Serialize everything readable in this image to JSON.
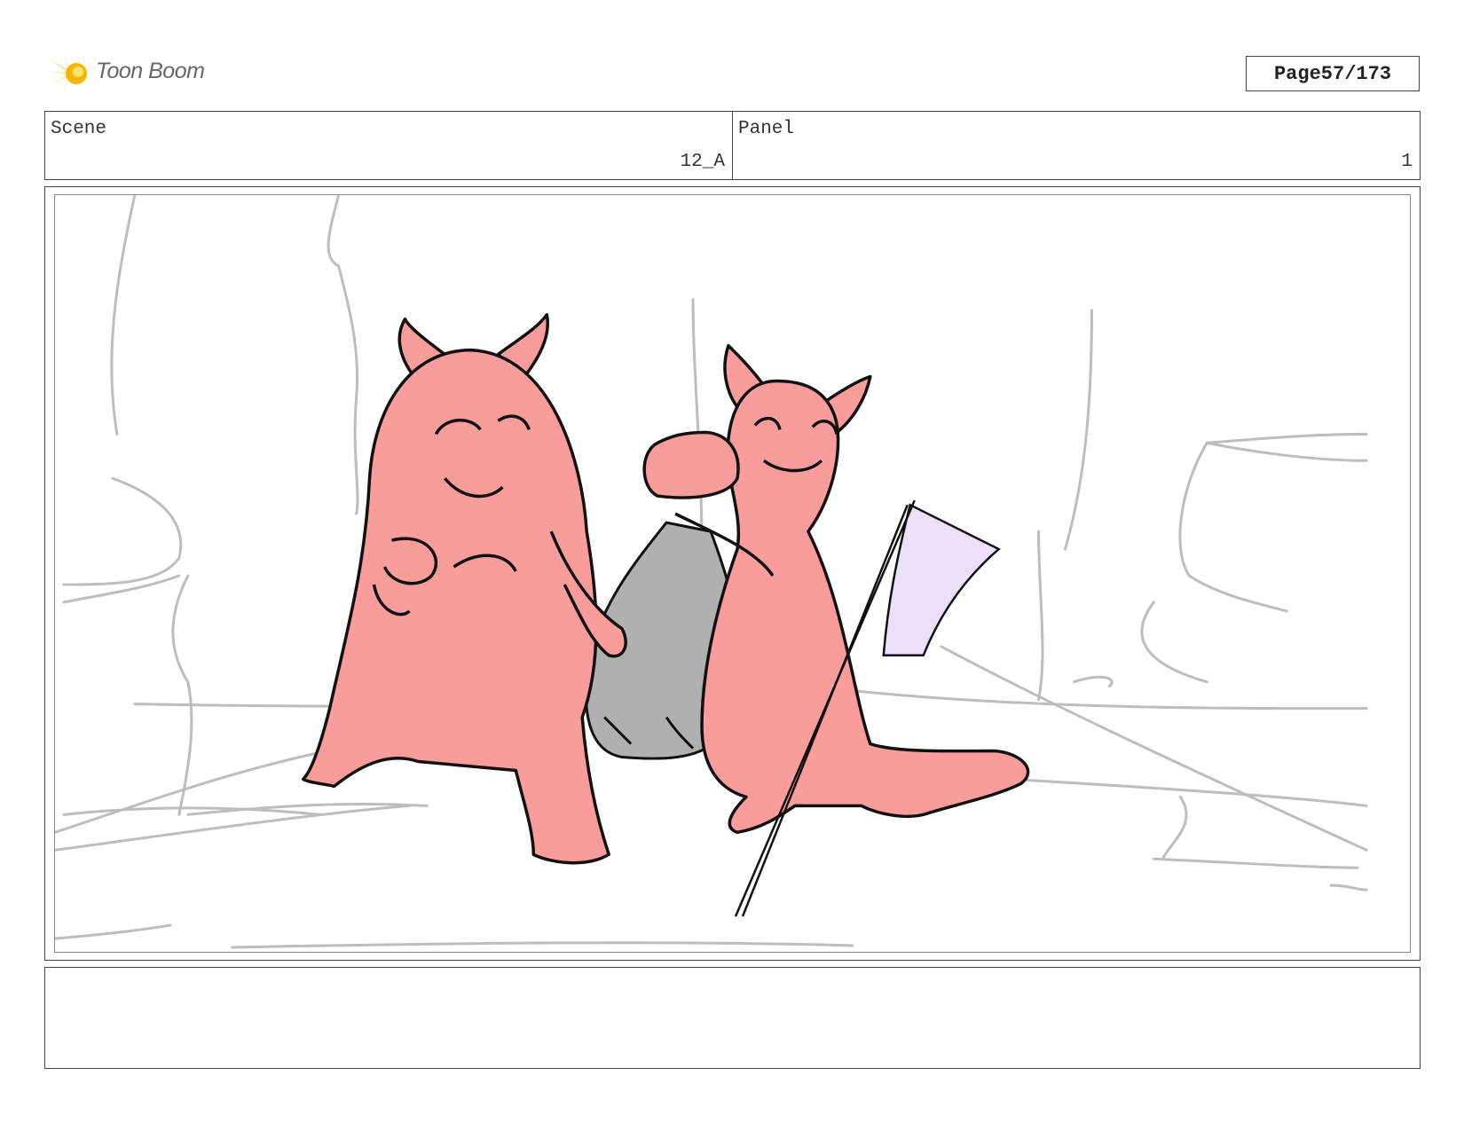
{
  "header": {
    "brand": "Toon Boom",
    "page_label": "Page",
    "page_number": "57/173"
  },
  "info": {
    "scene_label": "Scene",
    "scene_value": "12_A",
    "panel_label": "Panel",
    "panel_value": "1"
  },
  "notes": {
    "text": ""
  },
  "colors": {
    "creature_fill": "#f89c9c",
    "rock_fill": "#b0b0b0",
    "flag_fill": "#ece0f8",
    "sketch_line": "#bdbdbd",
    "ink": "#111111"
  },
  "icons": {
    "logo": "toon-boom-burst-icon"
  }
}
